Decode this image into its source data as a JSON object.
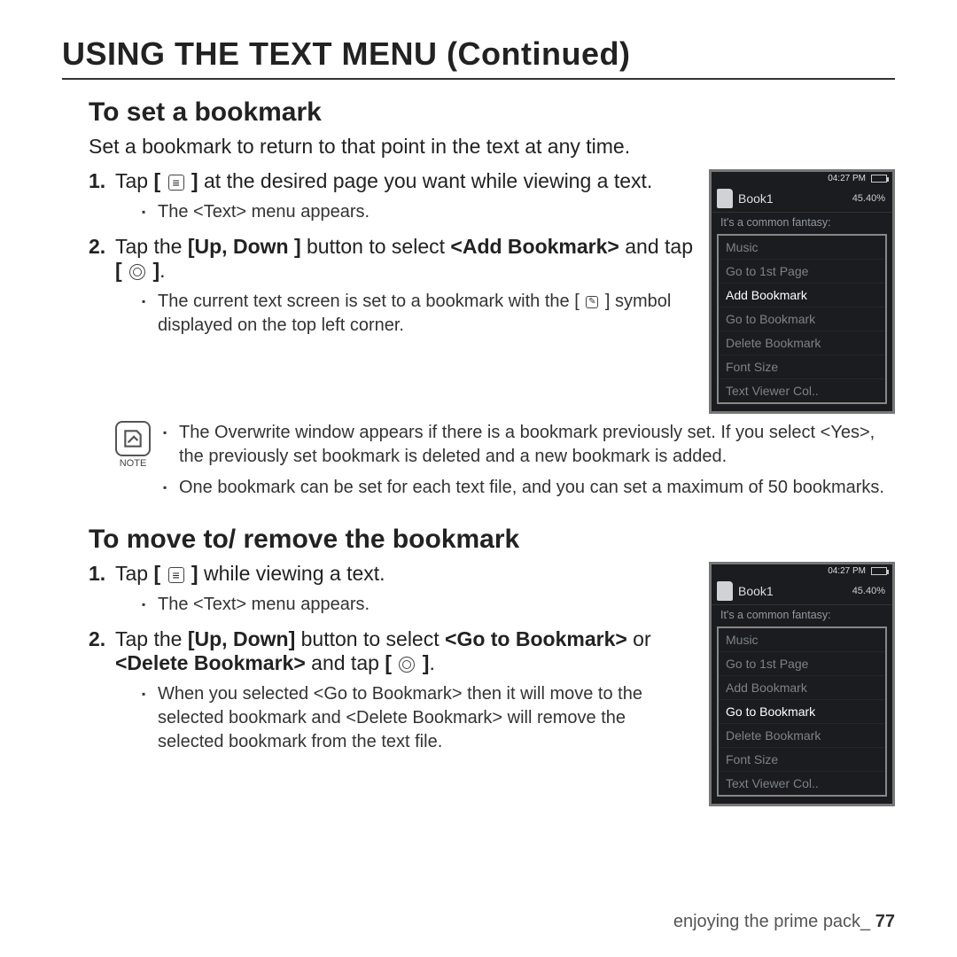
{
  "page_title": "USING THE TEXT MENU (Continued)",
  "section1": {
    "title": "To set a bookmark",
    "intro": "Set a bookmark to return to that point in the text at any time.",
    "step1_a": "Tap ",
    "step1_b": " at the desired page you want while viewing a text.",
    "step1_sub": "The <Text> menu appears.",
    "step2_a": "Tap the ",
    "step2_updown": "Up, Down ",
    "step2_b": " button to select ",
    "step2_add": "<Add Bookmark>",
    "step2_c": " and tap ",
    "step2_sub_a": "The current text screen is set to a bookmark with the ",
    "step2_sub_b": " symbol displayed on the top left corner.",
    "note1": "The Overwrite window appears if there is a bookmark previously set. If you select <Yes>, the previously set bookmark is deleted and a new bookmark is added.",
    "note2": "One bookmark can be set for each text file, and you can set a maximum of 50 bookmarks."
  },
  "section2": {
    "title": "To move to/ remove the bookmark",
    "step1_a": "Tap ",
    "step1_b": " while viewing a text.",
    "step1_sub": "The <Text> menu appears.",
    "step2_a": "Tap the ",
    "step2_updown": "Up, Down",
    "step2_b": " button to select ",
    "step2_goto": "<Go to Bookmark>",
    "step2_or": " or ",
    "step2_del": "<Delete Bookmark>",
    "step2_c": " and tap ",
    "step2_sub": "When you selected <Go to Bookmark> then it will move to the selected bookmark and <Delete Bookmark> will remove the selected bookmark from the text file."
  },
  "note_label": "NOTE",
  "device1": {
    "time": "04:27 PM",
    "book": "Book1",
    "percent": "45.40%",
    "fantasy": "It's a common fantasy:",
    "menu": [
      "Music",
      "Go to 1st Page",
      "Add Bookmark",
      "Go to Bookmark",
      "Delete Bookmark",
      "Font Size",
      "Text Viewer Col.."
    ],
    "selected": "Add Bookmark"
  },
  "device2": {
    "time": "04:27 PM",
    "book": "Book1",
    "percent": "45.40%",
    "fantasy": "It's a common fantasy:",
    "menu": [
      "Music",
      "Go to 1st Page",
      "Add Bookmark",
      "Go to Bookmark",
      "Delete Bookmark",
      "Font Size",
      "Text Viewer Col.."
    ],
    "selected": "Go to Bookmark"
  },
  "footer": {
    "text": "enjoying the prime pack_ ",
    "page": "77"
  }
}
